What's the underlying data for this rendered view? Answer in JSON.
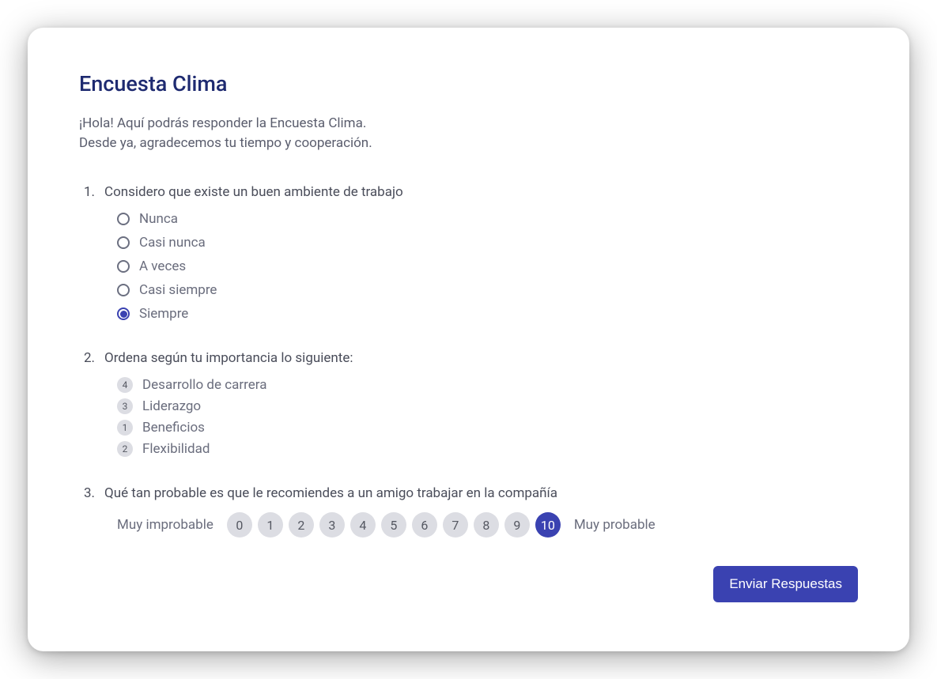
{
  "title": "Encuesta Clima",
  "intro_line1": "¡Hola! Aquí podrás responder la Encuesta Clima.",
  "intro_line2": "Desde ya, agradecemos tu tiempo y cooperación.",
  "questions": {
    "q1": {
      "number": "1.",
      "text": "Considero que existe un buen ambiente de trabajo",
      "options": [
        {
          "label": "Nunca",
          "selected": false
        },
        {
          "label": "Casi nunca",
          "selected": false
        },
        {
          "label": "A veces",
          "selected": false
        },
        {
          "label": "Casi siempre",
          "selected": false
        },
        {
          "label": "Siempre",
          "selected": true
        }
      ]
    },
    "q2": {
      "number": "2.",
      "text": "Ordena según tu importancia lo siguiente:",
      "items": [
        {
          "rank": "4",
          "label": "Desarrollo de carrera"
        },
        {
          "rank": "3",
          "label": "Liderazgo"
        },
        {
          "rank": "1",
          "label": "Beneficios"
        },
        {
          "rank": "2",
          "label": "Flexibilidad"
        }
      ]
    },
    "q3": {
      "number": "3.",
      "text": "Qué tan probable es que le recomiendes a un amigo trabajar en la compañía",
      "low_label": "Muy improbable",
      "high_label": "Muy probable",
      "values": [
        "0",
        "1",
        "2",
        "3",
        "4",
        "5",
        "6",
        "7",
        "8",
        "9",
        "10"
      ],
      "selected": "10"
    }
  },
  "submit_label": "Enviar Respuestas"
}
